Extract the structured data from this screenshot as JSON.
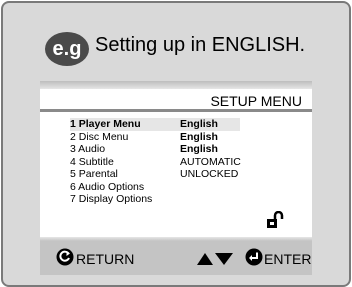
{
  "example_badge": "e.g",
  "heading": "Setting up in ENGLISH.",
  "menu": {
    "title": "SETUP MENU",
    "items": [
      {
        "label": "1 Player Menu",
        "value": "English",
        "highlighted": true
      },
      {
        "label": "2 Disc Menu",
        "value": "English",
        "highlighted": false
      },
      {
        "label": "3 Audio",
        "value": "English",
        "highlighted": false
      },
      {
        "label": "4 Subtitle",
        "value": "AUTOMATIC",
        "highlighted": false
      },
      {
        "label": "5 Parental",
        "value": "UNLOCKED",
        "highlighted": false
      },
      {
        "label": "6 Audio Options",
        "value": "",
        "highlighted": false
      },
      {
        "label": "7 Display Options",
        "value": "",
        "highlighted": false
      }
    ]
  },
  "footer": {
    "return_label": "RETURN",
    "enter_label": "ENTER"
  },
  "icons": {
    "return": "return-icon",
    "updown": "up-down-arrows-icon",
    "enter": "enter-icon",
    "lock": "unlocked-padlock-icon"
  }
}
